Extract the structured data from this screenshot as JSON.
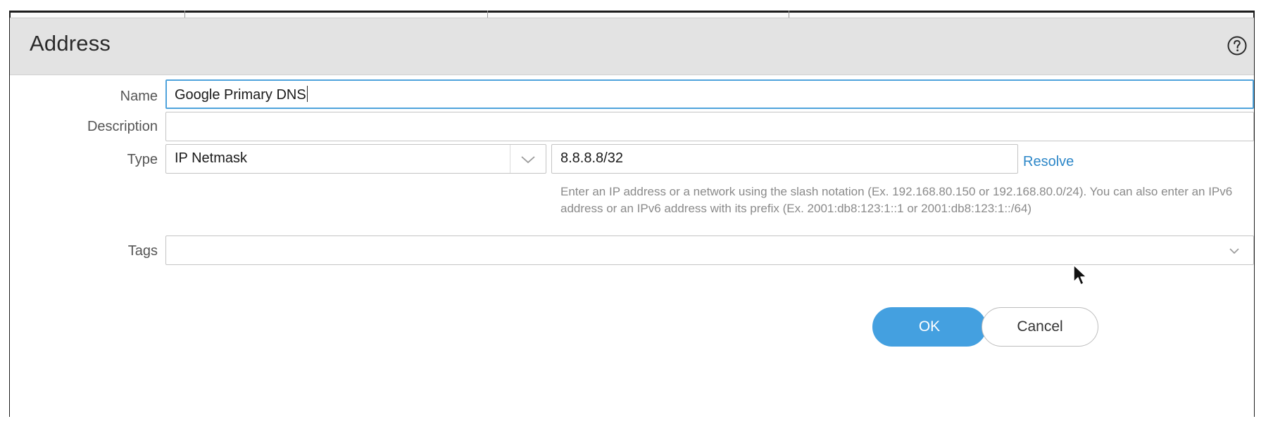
{
  "dialog": {
    "title": "Address",
    "help_icon": "help-circle-icon"
  },
  "form": {
    "name": {
      "label": "Name",
      "value": "Google Primary DNS"
    },
    "description": {
      "label": "Description",
      "value": ""
    },
    "type": {
      "label": "Type",
      "selected": "IP Netmask",
      "address_value": "8.8.8.8/32",
      "resolve_label": "Resolve",
      "helper_text": "Enter an IP address or a network using the slash notation (Ex. 192.168.80.150 or 192.168.80.0/24). You can also enter an IPv6 address or an IPv6 address with its prefix (Ex. 2001:db8:123:1::1 or 2001:db8:123:1::/64)"
    },
    "tags": {
      "label": "Tags",
      "value": ""
    }
  },
  "buttons": {
    "ok_label": "OK",
    "cancel_label": "Cancel"
  },
  "colors": {
    "accent": "#44a0e0",
    "link": "#2d87c8",
    "header_bg": "#e3e3e3",
    "focus_border": "#4fa3dc"
  }
}
